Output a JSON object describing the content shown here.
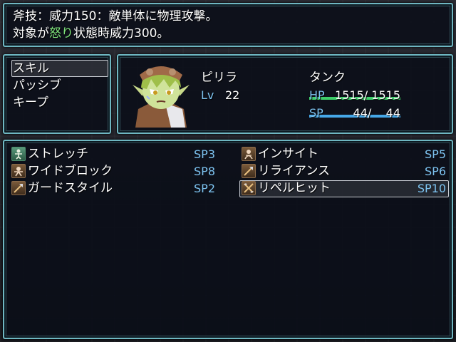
{
  "help": {
    "line1": "斧技：威力150：敵単体に物理攻撃。",
    "line2_before": "対象が",
    "line2_highlight": "怒り",
    "line2_after": "状態時威力300。",
    "highlight_color": "#7ee07a"
  },
  "commands": [
    "スキル",
    "パッシブ",
    "キープ"
  ],
  "selected_command": "スキル",
  "actor": {
    "name": "ピリラ",
    "class": "タンク",
    "level_label": "Lv",
    "level": "22",
    "hp_label": "HP",
    "hp_value": "1515/ 1515",
    "hp_fraction": 1.0,
    "sp_label": "SP",
    "sp_value": "44/    44",
    "sp_fraction": 1.0,
    "hp_gauge_color": "#3ecf6a",
    "sp_gauge_color": "#46a8e8"
  },
  "skills": [
    {
      "name": "ストレッチ",
      "cost": "SP3",
      "icon": "stretch-icon"
    },
    {
      "name": "インサイト",
      "cost": "SP5",
      "icon": "insight-icon"
    },
    {
      "name": "ワイドブロック",
      "cost": "SP8",
      "icon": "wide-block-icon"
    },
    {
      "name": "リライアンス",
      "cost": "SP6",
      "icon": "axe-icon"
    },
    {
      "name": "ガードスタイル",
      "cost": "SP2",
      "icon": "axe-icon"
    },
    {
      "name": "リペルヒット",
      "cost": "SP10",
      "icon": "crossed-axes-icon"
    }
  ],
  "selected_skill": "リペルヒット",
  "colors": {
    "window_border": "#6fb7c2",
    "system_text": "#7dc3f0"
  }
}
